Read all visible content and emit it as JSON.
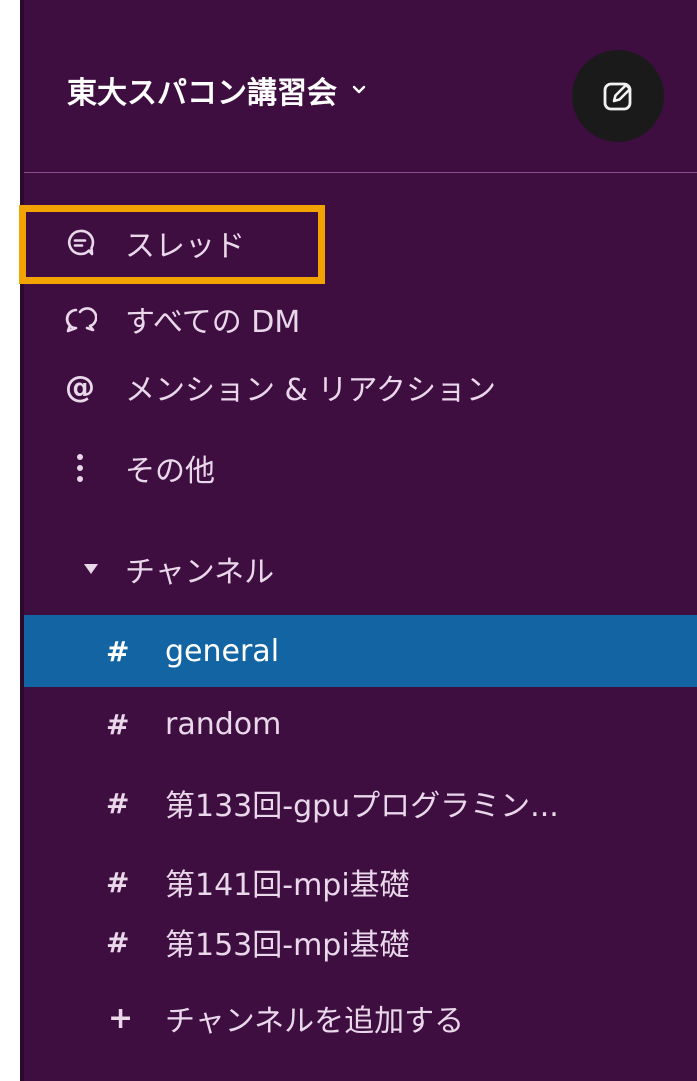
{
  "workspace": {
    "name": "東大スパコン講習会",
    "menu_icon": "chevron-down-icon",
    "compose_icon": "compose-icon"
  },
  "nav": {
    "items": [
      {
        "label": "スレッド",
        "icon": "threads-icon",
        "highlighted": true
      },
      {
        "label": "すべての DM",
        "icon": "dm-icon"
      },
      {
        "label": "メンション & リアクション",
        "icon": "at-icon"
      },
      {
        "label": "その他",
        "icon": "more-icon"
      }
    ]
  },
  "channels": {
    "section_label": "チャンネル",
    "items": [
      {
        "name": "general",
        "active": true
      },
      {
        "name": "random"
      },
      {
        "name": "第133回-gpuプログラミン..."
      },
      {
        "name": "第141回-mpi基礎"
      },
      {
        "name": "第153回-mpi基礎"
      }
    ],
    "hash_symbol": "#",
    "add_label": "チャンネルを追加する",
    "add_symbol": "+"
  },
  "colors": {
    "sidebar_bg": "#3f0e40",
    "active_bg": "#1264a3",
    "highlight": "#f2a300",
    "text": "#e9d7ea"
  }
}
